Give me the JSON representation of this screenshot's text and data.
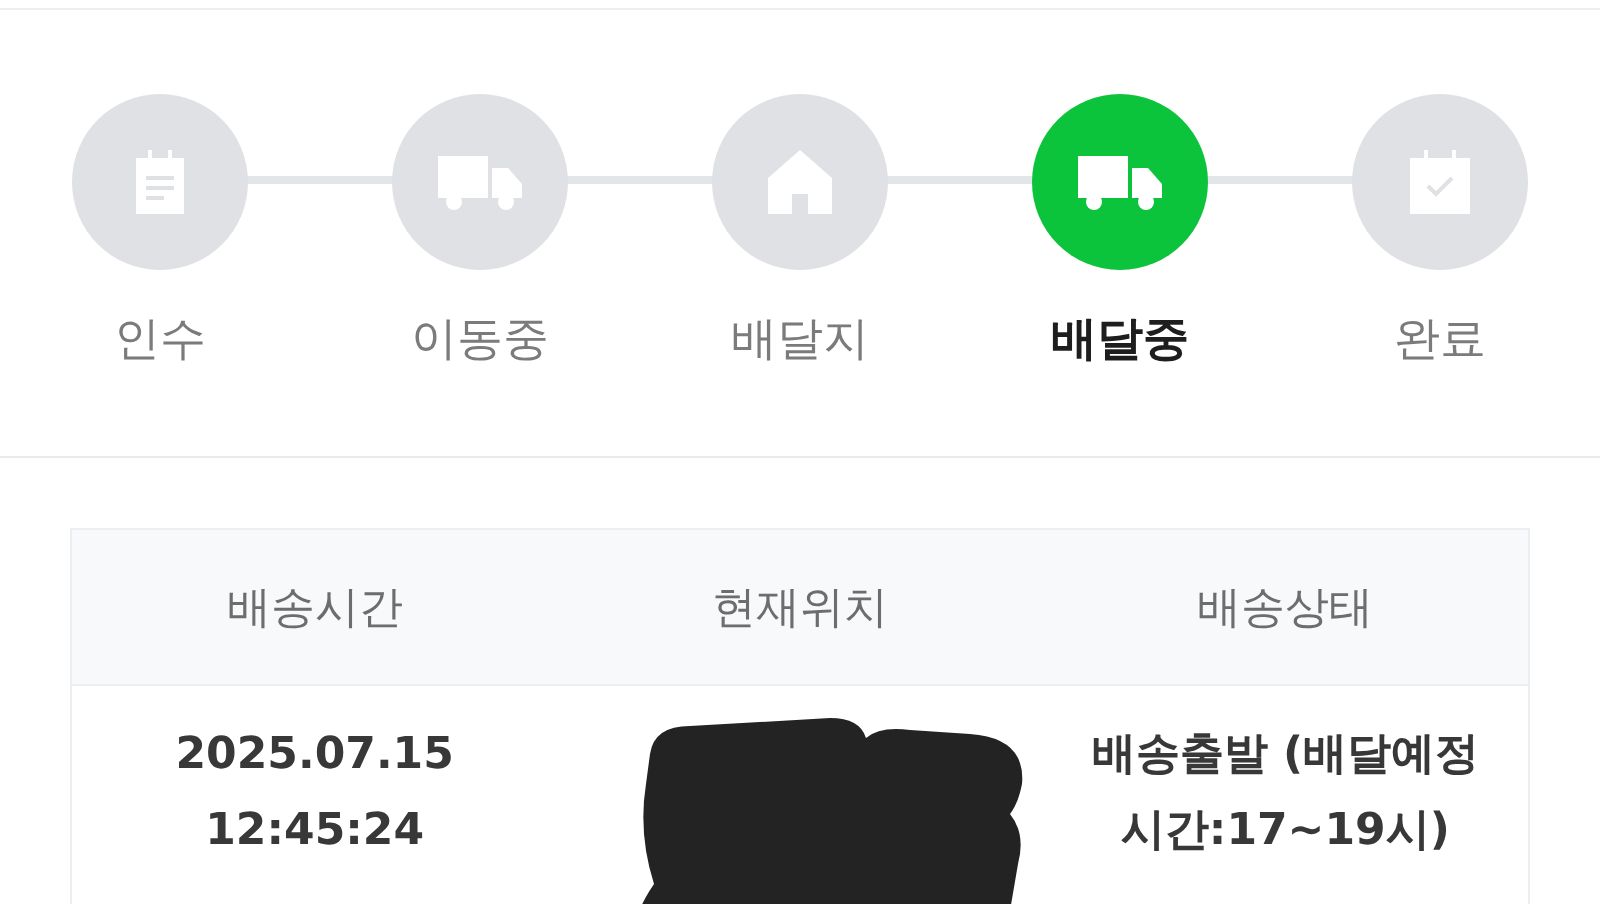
{
  "steps": [
    {
      "label": "인수",
      "kind": "clipboard",
      "selected": false
    },
    {
      "label": "이동중",
      "kind": "truck",
      "selected": false
    },
    {
      "label": "배달지",
      "kind": "house",
      "selected": false
    },
    {
      "label": "배달중",
      "kind": "truck",
      "selected": true
    },
    {
      "label": "완료",
      "kind": "calendar",
      "selected": false
    }
  ],
  "table": {
    "columns": [
      "배송시간",
      "현재위치",
      "배송상태"
    ],
    "rows": [
      {
        "time": [
          "2025.07.15",
          "12:45:24"
        ],
        "location_redacted": true,
        "status": "배송출발 (배달예정 시간:17~19시)"
      }
    ]
  }
}
